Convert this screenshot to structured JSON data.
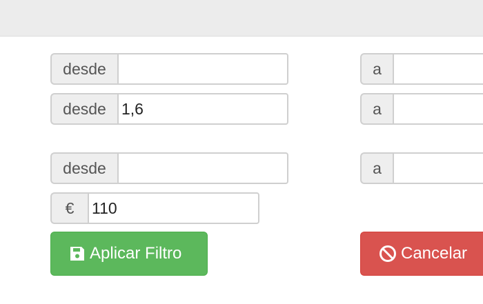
{
  "filters": {
    "row1": {
      "from_label": "desde",
      "from_value": "",
      "to_label": "a",
      "to_value": ""
    },
    "row2": {
      "from_label": "desde",
      "from_value": "1,6",
      "to_label": "a",
      "to_value": ""
    },
    "row3": {
      "from_label": "desde",
      "from_value": "",
      "to_label": "a",
      "to_value": ""
    },
    "price": {
      "currency_symbol": "€",
      "value": "110"
    }
  },
  "buttons": {
    "apply_label": "Aplicar Filtro",
    "apply_icon": "floppy-disk-icon",
    "cancel_label": "Cancelar",
    "cancel_icon": "ban-icon"
  },
  "colors": {
    "apply": "#5cb85c",
    "cancel": "#d9534f",
    "addon_bg": "#eeeeee"
  }
}
